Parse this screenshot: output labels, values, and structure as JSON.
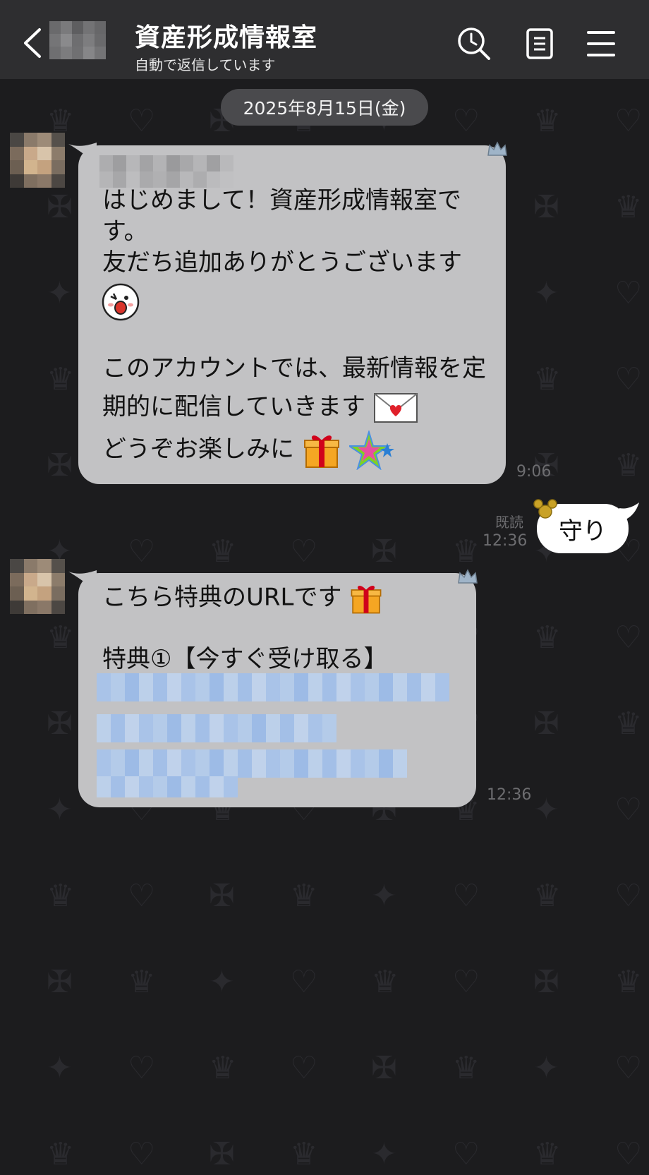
{
  "header": {
    "title": "資産形成情報室",
    "subtitle": "自動で返信しています"
  },
  "date_divider": "2025年8月15日(金)",
  "messages": [
    {
      "lines": [
        "はじめまして！資産形成情報室で",
        "す。",
        "友だち追加ありがとうございます",
        "このアカウントでは、最新情報を定",
        "期的に配信していきます",
        "どうぞお楽しみに"
      ],
      "time": "9:06"
    },
    {
      "text": "守り",
      "read": "既読",
      "time": "12:36"
    },
    {
      "lines": [
        "こちら特典のURLです",
        "特典①【今すぐ受け取る】"
      ],
      "time": "12:36"
    }
  ],
  "icons": {
    "back": "chevron-left-icon",
    "search": "search-icon",
    "notes": "notes-icon",
    "menu": "hamburger-menu-icon"
  },
  "colors": {
    "header_bg": "#2e2e30",
    "background": "#1c1c1e",
    "bubble_in": "#c2c2c4",
    "bubble_out": "#ffffff"
  }
}
